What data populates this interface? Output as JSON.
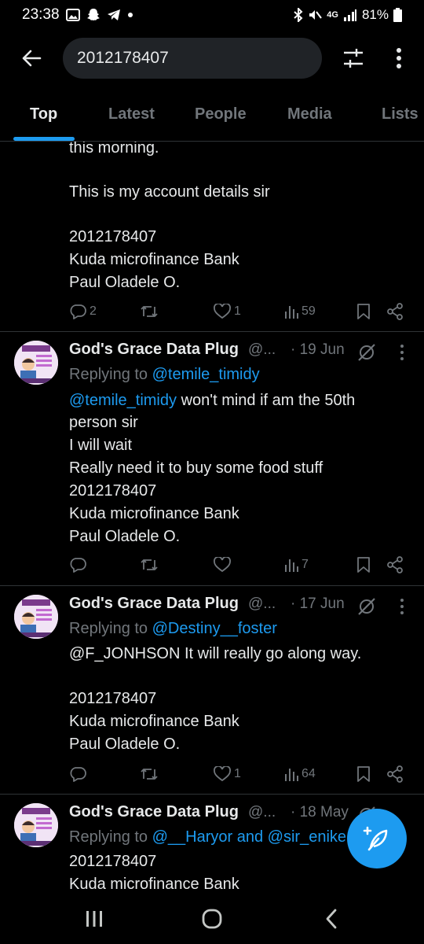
{
  "status_bar": {
    "time": "23:38",
    "network": "4G",
    "battery": "81%"
  },
  "search": {
    "query": "2012178407"
  },
  "tabs": [
    {
      "label": "Top",
      "active": true
    },
    {
      "label": "Latest",
      "active": false
    },
    {
      "label": "People",
      "active": false
    },
    {
      "label": "Media",
      "active": false
    },
    {
      "label": "Lists",
      "active": false
    }
  ],
  "partial_tweet": {
    "lines": [
      "this morning.",
      "",
      "This is my account details sir",
      "",
      "2012178407",
      "Kuda microfinance Bank",
      "Paul Oladele O."
    ],
    "replies": "2",
    "retweets": "",
    "likes": "1",
    "views": "59"
  },
  "tweets": [
    {
      "display_name": "God's Grace Data Plug",
      "handle": "@...",
      "date": "· 19 Jun",
      "replying_prefix": "Replying to ",
      "replying_to": "@temile_timidy",
      "body_mention": "@temile_timidy",
      "body_first": " won't mind if am the 50th",
      "lines": [
        "person sir",
        "I will wait",
        "Really need it to buy some food stuff",
        "2012178407",
        "Kuda microfinance Bank",
        "Paul Oladele O."
      ],
      "replies": "",
      "retweets": "",
      "likes": "",
      "views": "7"
    },
    {
      "display_name": "God's Grace Data Plug",
      "handle": "@...",
      "date": "· 17 Jun",
      "replying_prefix": "Replying to ",
      "replying_to": "@Destiny__foster",
      "body_first": "@F_JONHSON It will really go along way.",
      "lines": [
        "",
        "2012178407",
        "Kuda microfinance Bank",
        "Paul Oladele O."
      ],
      "replies": "",
      "retweets": "",
      "likes": "1",
      "views": "64"
    },
    {
      "display_name": "God's Grace Data Plug",
      "handle": "@...",
      "date": "· 18 May",
      "replying_prefix": "Replying to ",
      "replying_to": "@__Haryor and @sir_enike",
      "lines": [
        "2012178407",
        "Kuda microfinance Bank"
      ]
    }
  ],
  "colors": {
    "background": "#000000",
    "text": "#e7e9ea",
    "muted": "#71767b",
    "accent": "#1d9bf0",
    "divider": "#2f3336"
  },
  "icons": [
    "back-arrow-icon",
    "filter-sliders-icon",
    "more-vertical-icon",
    "reply-icon",
    "retweet-icon",
    "like-icon",
    "views-icon",
    "bookmark-icon",
    "share-icon",
    "grok-icon",
    "compose-feather-icon"
  ]
}
